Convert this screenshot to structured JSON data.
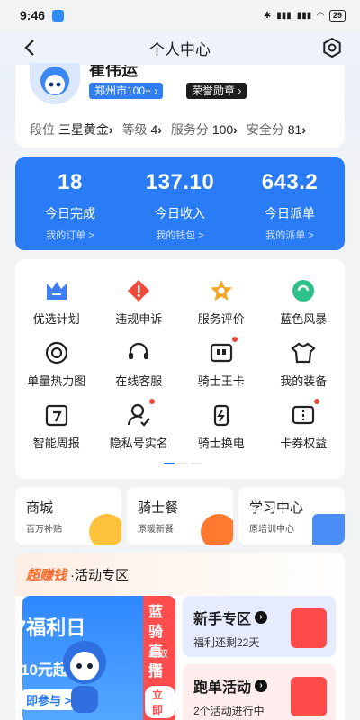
{
  "status": {
    "time": "9:46",
    "battery": "29"
  },
  "header": {
    "title": "个人中心"
  },
  "profile": {
    "name": "崔伟运",
    "city_badge": "郑州市100+",
    "honor_badge": "荣誉勋章",
    "stats": [
      {
        "label": "段位",
        "value": "三星黄金"
      },
      {
        "label": "等级",
        "value": "4"
      },
      {
        "label": "服务分",
        "value": "100"
      },
      {
        "label": "安全分",
        "value": "81"
      }
    ]
  },
  "summary": [
    {
      "value": "18",
      "label": "今日完成",
      "link": "我的订单 >"
    },
    {
      "value": "137.10",
      "label": "今日收入",
      "link": "我的钱包 >"
    },
    {
      "value": "643.2",
      "label": "今日派单",
      "link": "我的派单 >"
    }
  ],
  "menu": [
    {
      "label": "优选计划",
      "icon": "crown-icon",
      "color": "#3d7ef6"
    },
    {
      "label": "违规申诉",
      "icon": "warning-icon",
      "color": "#f04a3a"
    },
    {
      "label": "服务评价",
      "icon": "star-icon",
      "color": "#f5a623"
    },
    {
      "label": "蓝色风暴",
      "icon": "storm-icon",
      "color": "#2ec28a"
    },
    {
      "label": "单量热力图",
      "icon": "heatmap-icon",
      "color": "#222"
    },
    {
      "label": "在线客服",
      "icon": "headset-icon",
      "color": "#222"
    },
    {
      "label": "骑士王卡",
      "icon": "card-icon",
      "color": "#222"
    },
    {
      "label": "我的装备",
      "icon": "tshirt-icon",
      "color": "#222"
    },
    {
      "label": "智能周报",
      "icon": "calendar-icon",
      "color": "#222"
    },
    {
      "label": "隐私号实名",
      "icon": "user-privacy-icon",
      "color": "#222"
    },
    {
      "label": "骑士换电",
      "icon": "battery-swap-icon",
      "color": "#222"
    },
    {
      "label": "卡券权益",
      "icon": "coupon-icon",
      "color": "#222"
    }
  ],
  "shops": [
    {
      "title": "商城",
      "sub": "百万补贴"
    },
    {
      "title": "骑士餐",
      "sub": "原暖新餐"
    },
    {
      "title": "学习中心",
      "sub": "原培训中心"
    }
  ],
  "activity": {
    "hot": "超赚钱",
    "title": "·活动专区",
    "banner": {
      "line1": "7福利日",
      "line2": "10元起",
      "cta": "即参与 >",
      "side_title": "蓝骑直播",
      "side_sub": "每双周",
      "side_cta": "立即"
    },
    "promos": [
      {
        "title": "新手专区",
        "sub": "福利还剩22天"
      },
      {
        "title": "跑单活动",
        "sub": "2个活动进行中"
      }
    ]
  }
}
